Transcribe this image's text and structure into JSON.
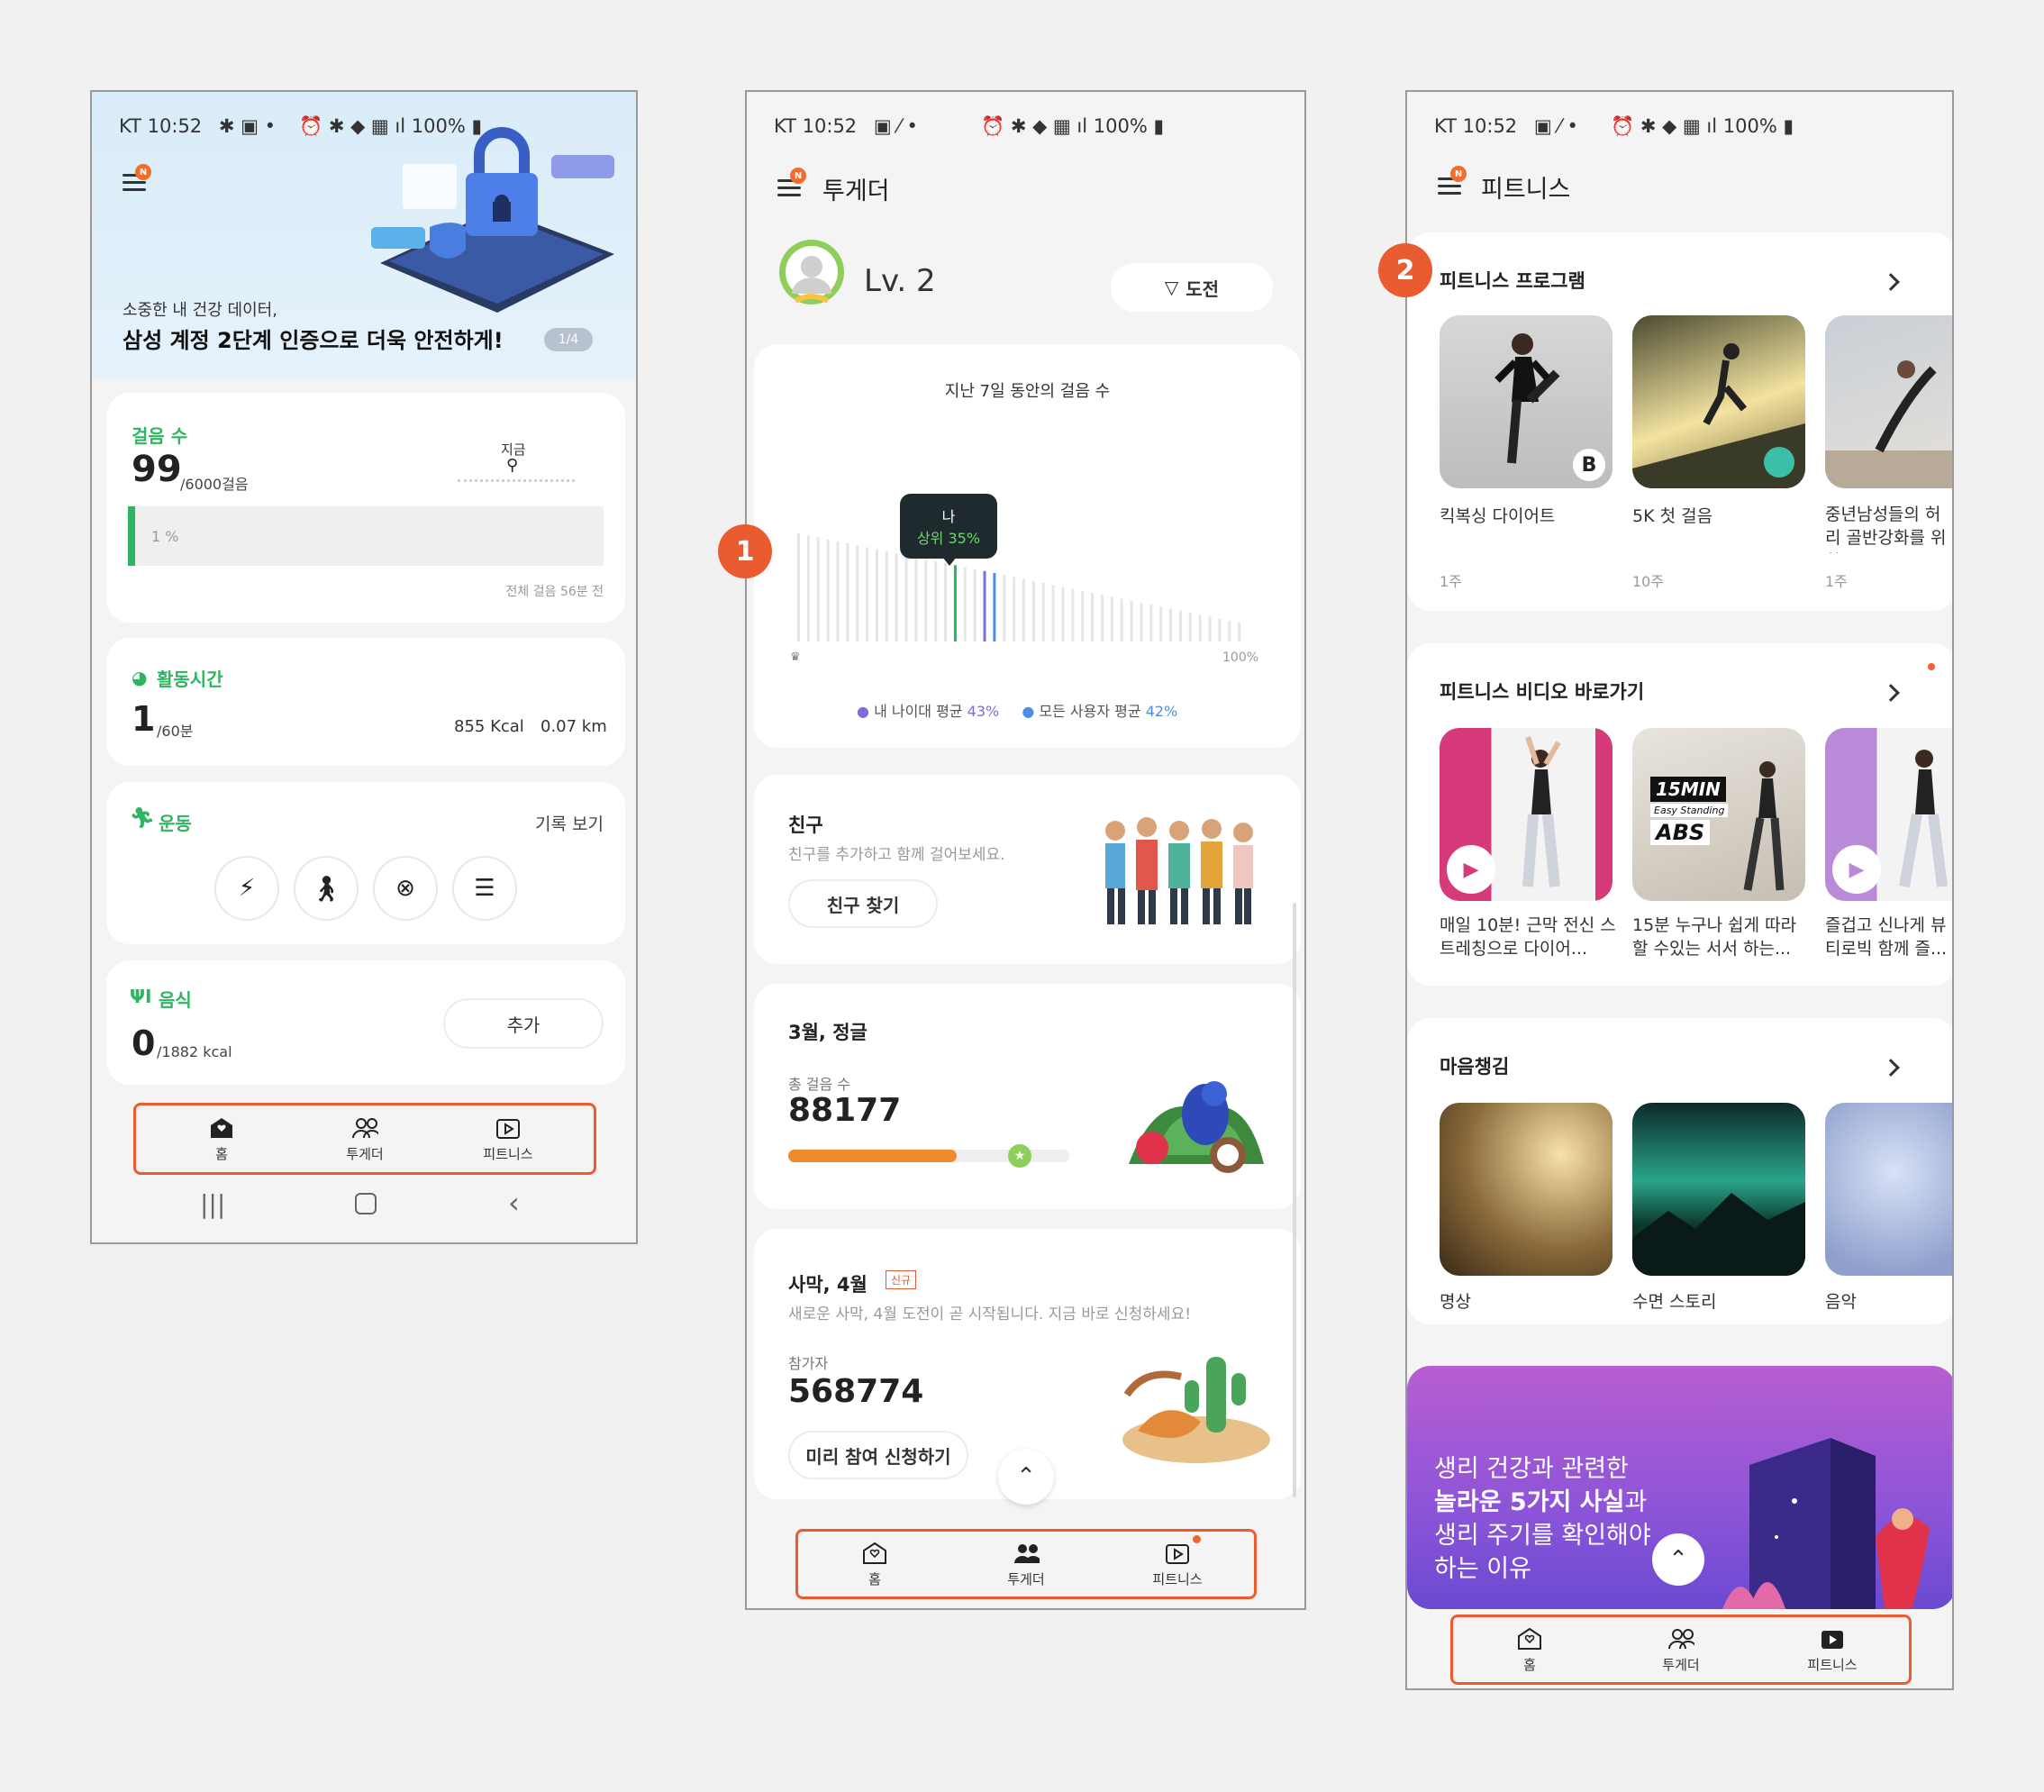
{
  "status_bar": {
    "carrier_time": "KT 10:52",
    "right": "100%"
  },
  "screen1": {
    "banner": {
      "subtitle": "소중한 내 건강 데이터,",
      "title": "삼성 계정 2단계 인증으로 더욱 안전하게!",
      "page": "1/4"
    },
    "steps": {
      "label": "걸음 수",
      "value": "99",
      "goal": "/6000걸음",
      "now_label": "지금",
      "percent_label": "1 %",
      "percent": 1,
      "footer": "전체 걸음 56분 전"
    },
    "activity": {
      "label": "활동시간",
      "value": "1",
      "goal": "/60분",
      "kcal": "855 Kcal",
      "km": "0.07 km"
    },
    "exercise": {
      "label": "운동",
      "history": "기록 보기"
    },
    "food": {
      "label": "음식",
      "value": "0",
      "goal": "/1882 kcal",
      "add": "추가"
    },
    "nav": {
      "home": "홈",
      "together": "투게더",
      "fitness": "피트니스"
    }
  },
  "screen2": {
    "title": "투게더",
    "level": "Lv. 2",
    "challenge": "도전",
    "chart_title": "지난 7일 동안의 걸음 수",
    "tooltip_me": "나",
    "tooltip_rank": "상위 35%",
    "axis_end": "100%",
    "legend_age": "내 나이대 평균",
    "legend_age_val": "43%",
    "legend_all": "모든 사용자 평균",
    "legend_all_val": "42%",
    "friends": {
      "title": "친구",
      "desc": "친구를 추가하고 함께 걸어보세요.",
      "button": "친구 찾기"
    },
    "march": {
      "title": "3월, 정글",
      "label": "총 걸음 수",
      "value": "88177",
      "progress": 0.6
    },
    "desert": {
      "title": "사막, 4월",
      "tag": "신규",
      "desc": "새로운 사막, 4월 도전이 곧 시작됩니다. 지금 바로 신청하세요!",
      "label": "참가자",
      "value": "568774",
      "button": "미리 참여 신청하기"
    },
    "nav": {
      "home": "홈",
      "together": "투게더",
      "fitness": "피트니스"
    }
  },
  "screen3": {
    "title": "피트니스",
    "programs": {
      "title": "피트니스 프로그램",
      "items": [
        {
          "name": "킥복싱 다이어트",
          "dur": "1주",
          "badge": "B"
        },
        {
          "name": "5K 첫 걸음",
          "dur": "10주"
        },
        {
          "name": "중년남성들의 허리 골반강화를 위한...",
          "dur": "1주"
        }
      ]
    },
    "videos": {
      "title": "피트니스 비디오 바로가기",
      "items": [
        {
          "name": "매일 10분! 근막 전신 스트레칭으로 다이어..."
        },
        {
          "name": "15분 누구나 쉽게 따라 할 수있는 서서 하는...",
          "t1": "15MIN",
          "t2": "Easy Standing",
          "t3": "ABS"
        },
        {
          "name": "즐겁고 신나게 뷰티로빅 함께 즐..."
        }
      ]
    },
    "mind": {
      "title": "마음챙김",
      "items": [
        {
          "name": "명상"
        },
        {
          "name": "수면 스토리"
        },
        {
          "name": "음악"
        }
      ]
    },
    "promo": {
      "l1": "생리 건강과 관련한",
      "l2": "놀라운 5가지 사실",
      "l2b": "과",
      "l3": "생리 주기를 확인해야",
      "l4": "하는 이유"
    },
    "nav": {
      "home": "홈",
      "together": "투게더",
      "fitness": "피트니스"
    }
  },
  "annotations": {
    "one": "1",
    "two": "2"
  }
}
